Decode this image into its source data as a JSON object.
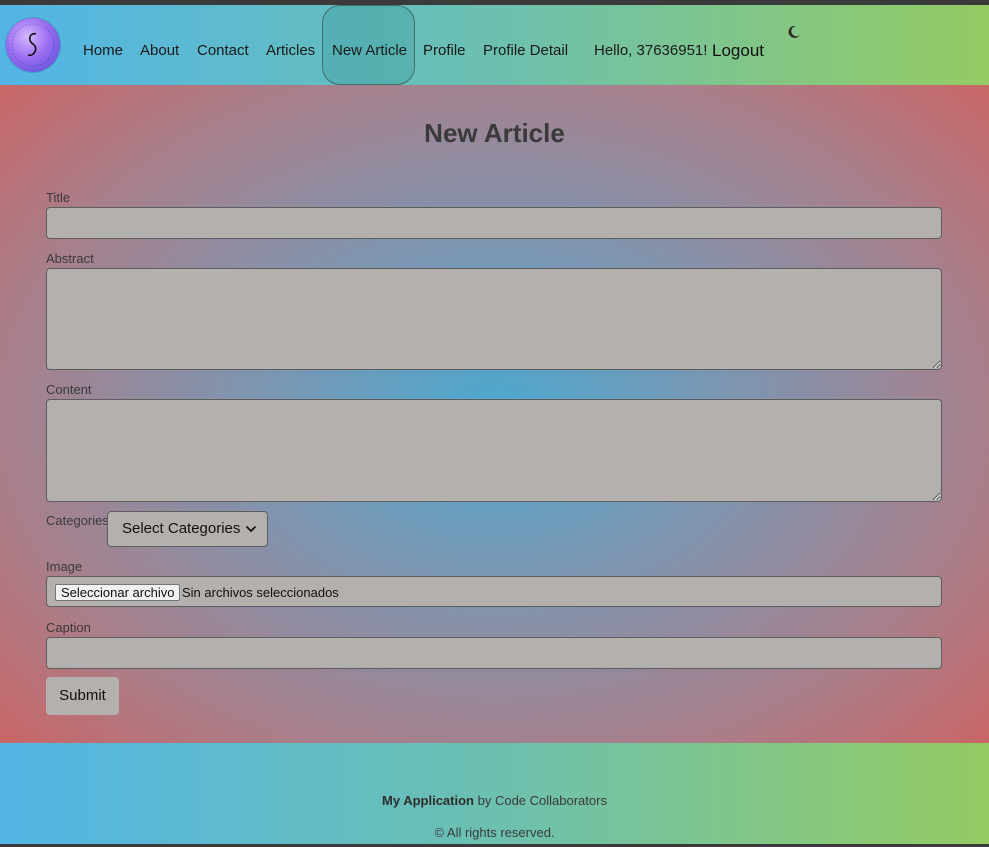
{
  "nav": {
    "items": [
      {
        "label": "Home"
      },
      {
        "label": "About"
      },
      {
        "label": "Contact"
      },
      {
        "label": "Articles"
      },
      {
        "label": "New Article"
      },
      {
        "label": "Profile"
      },
      {
        "label": "Profile Detail"
      }
    ],
    "active": "New Article",
    "greeting": "Hello, 37636951!",
    "logout_label": "Logout",
    "theme_icon": "moon-icon"
  },
  "page": {
    "title": "New Article"
  },
  "form": {
    "title_label": "Title",
    "title_value": "",
    "abstract_label": "Abstract",
    "abstract_value": "",
    "content_label": "Content",
    "content_value": "",
    "categories_label": "Categories",
    "categories_select": "Select Categories",
    "image_label": "Image",
    "file_button": "Seleccionar archivo",
    "file_status": "Sin archivos seleccionados",
    "caption_label": "Caption",
    "caption_value": "",
    "submit_label": "Submit"
  },
  "footer": {
    "app_name": "My Application",
    "by_text": "by Code Collaborators",
    "copyright": "© All rights reserved."
  },
  "colors": {
    "header_gradient_start": "#52b5e6",
    "header_gradient_end": "#94cb63",
    "main_center": "#4ba8cf",
    "main_edge": "#cc6464",
    "field_bg": "#b4b0ae"
  }
}
